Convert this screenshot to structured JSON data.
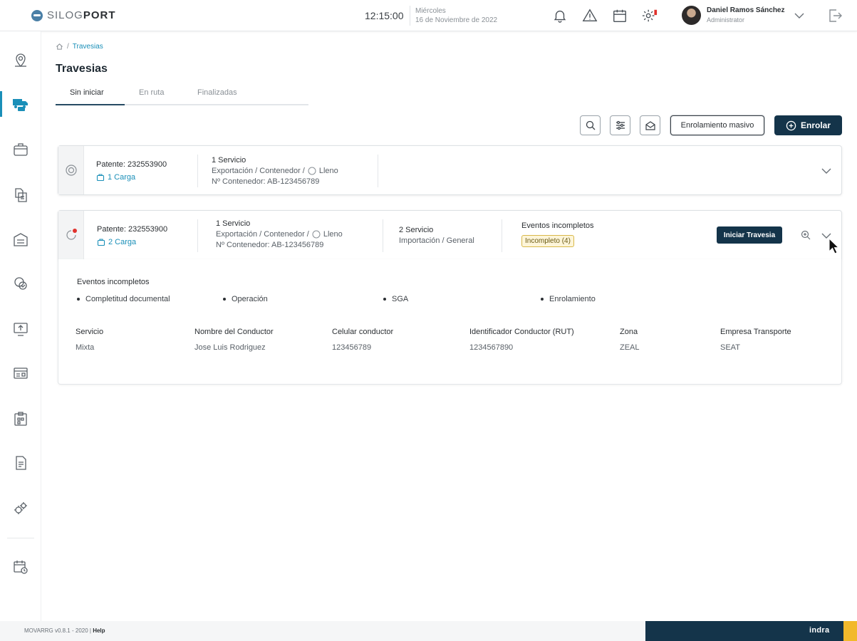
{
  "header": {
    "logo_prefix": "SILOG",
    "logo_suffix": "PORT",
    "time": "12:15:00",
    "day": "Miércoles",
    "date": "16 de Noviembre de 2022",
    "user_name": "Daniel Ramos Sánchez",
    "user_role": "Administrator",
    "icons": [
      "bell-icon",
      "warning-icon",
      "calendar-icon",
      "settings-alert-icon",
      "logout-icon"
    ]
  },
  "sidebar": {
    "items": [
      "map-pin-icon",
      "truck-monitor-icon",
      "cargo-box-icon",
      "documents-transfer-icon",
      "warehouse-icon",
      "checklist-cycle-icon",
      "upload-screen-icon",
      "id-panel-icon",
      "clipboard-grid-icon",
      "file-report-icon",
      "gears-icon",
      "calendar-clock-icon"
    ],
    "active_index": 1
  },
  "breadcrumb": {
    "current": "Travesias"
  },
  "page": {
    "title": "Travesias",
    "tabs": [
      "Sin iniciar",
      "En ruta",
      "Finalizadas"
    ]
  },
  "toolbar": {
    "bulk_label": "Enrolamiento masivo",
    "primary_label": "Enrolar"
  },
  "card1": {
    "patente": "Patente:  232553900",
    "carga": "1 Carga",
    "service_title": "1 Servicio",
    "service_type_prefix": "Exportación / Contenedor /",
    "service_state": "Lleno",
    "container": "Nº Contenedor: AB-123456789"
  },
  "card2": {
    "patente": "Patente:  232553900",
    "carga": "2 Carga",
    "service1_title": "1 Servicio",
    "service1_type_prefix": "Exportación / Contenedor /",
    "service1_state": "Lleno",
    "container": "Nº Contenedor: AB-123456789",
    "service2_title": "2 Servicio",
    "service2_type": "Importación / General",
    "events_title": "Eventos incompletos",
    "badge": "Incompleto (4)",
    "start_label": "Iniciar Travesia"
  },
  "details": {
    "events_title": "Eventos incompletos",
    "events": [
      "Completitud documental",
      "Operación",
      "SGA",
      "Enrolamiento"
    ],
    "columns": [
      "Servicio",
      "Nombre del Conductor",
      "Celular conductor",
      "Identificador Conductor (RUT)",
      "Zona",
      "Empresa Transporte"
    ],
    "values": [
      "Mixta",
      "Jose Luis Rodriguez",
      "123456789",
      "1234567890",
      "ZEAL",
      "SEAT"
    ]
  },
  "footer": {
    "version": "MOVARRG v0.8.1 - 2020 |",
    "help": "Help",
    "brand": "indra",
    "brand_color": "#14344a",
    "accent_color": "#f2b92b"
  }
}
